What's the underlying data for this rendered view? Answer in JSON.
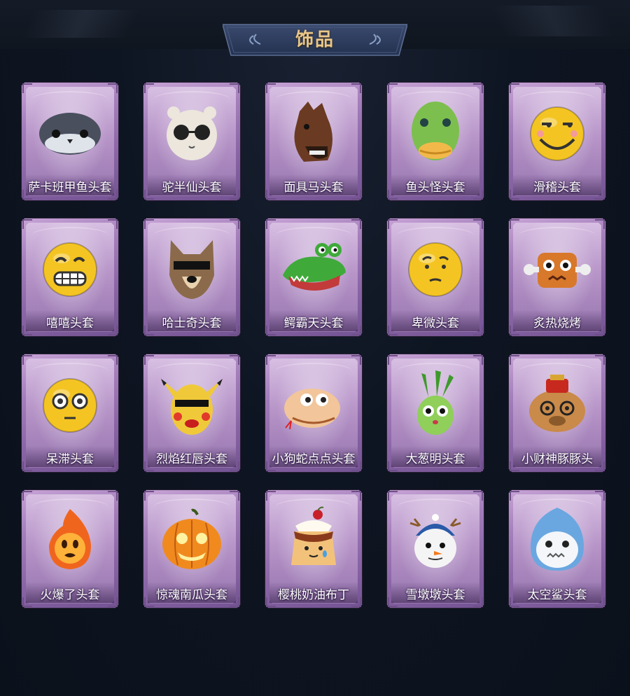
{
  "header": {
    "title": "饰品"
  },
  "items": [
    {
      "label": "萨卡班甲鱼头套",
      "icon": "armored-fish-head-icon",
      "color": "#4a4f5e"
    },
    {
      "label": "驼半仙头套",
      "icon": "alpaca-sunglasses-head-icon",
      "color": "#ece6dd"
    },
    {
      "label": "面具马头套",
      "icon": "horse-mask-icon",
      "color": "#6b3a22"
    },
    {
      "label": "鱼头怪头套",
      "icon": "fish-monster-head-icon",
      "color": "#7dbf4e"
    },
    {
      "label": "滑稽头套",
      "icon": "funny-smile-emoji-icon",
      "color": "#f4c522"
    },
    {
      "label": "嘻嘻头套",
      "icon": "grin-emoji-icon",
      "color": "#f4c522"
    },
    {
      "label": "哈士奇头套",
      "icon": "husky-sunglasses-head-icon",
      "color": "#8a6a4a"
    },
    {
      "label": "鳄霸天头套",
      "icon": "crocodile-head-icon",
      "color": "#3faa3a"
    },
    {
      "label": "卑微头套",
      "icon": "humble-emoji-icon",
      "color": "#f4c522"
    },
    {
      "label": "炙热烧烤",
      "icon": "roasted-meat-face-icon",
      "color": "#d7782a"
    },
    {
      "label": "呆滞头套",
      "icon": "dazed-emoji-icon",
      "color": "#f4c522"
    },
    {
      "label": "烈焰红唇头套",
      "icon": "yellow-mouse-sunglasses-icon",
      "color": "#f0c93a"
    },
    {
      "label": "小狗蛇点点头套",
      "icon": "snake-head-icon",
      "color": "#f2c59a"
    },
    {
      "label": "大葱明头套",
      "icon": "scallion-head-icon",
      "color": "#8fcf5a"
    },
    {
      "label": "小财神豚豚头",
      "icon": "capybara-fortune-head-icon",
      "color": "#c98a4a"
    },
    {
      "label": "火爆了头套",
      "icon": "fire-sprite-head-icon",
      "color": "#f0651e"
    },
    {
      "label": "惊魂南瓜头套",
      "icon": "pumpkin-head-icon",
      "color": "#f08a1e"
    },
    {
      "label": "樱桃奶油布丁",
      "icon": "cherry-pudding-head-icon",
      "color": "#f3c27a"
    },
    {
      "label": "雪墩墩头套",
      "icon": "snowman-reindeer-head-icon",
      "color": "#f4f4f4"
    },
    {
      "label": "太空鲨头套",
      "icon": "space-shark-head-icon",
      "color": "#6aa7e0"
    }
  ]
}
